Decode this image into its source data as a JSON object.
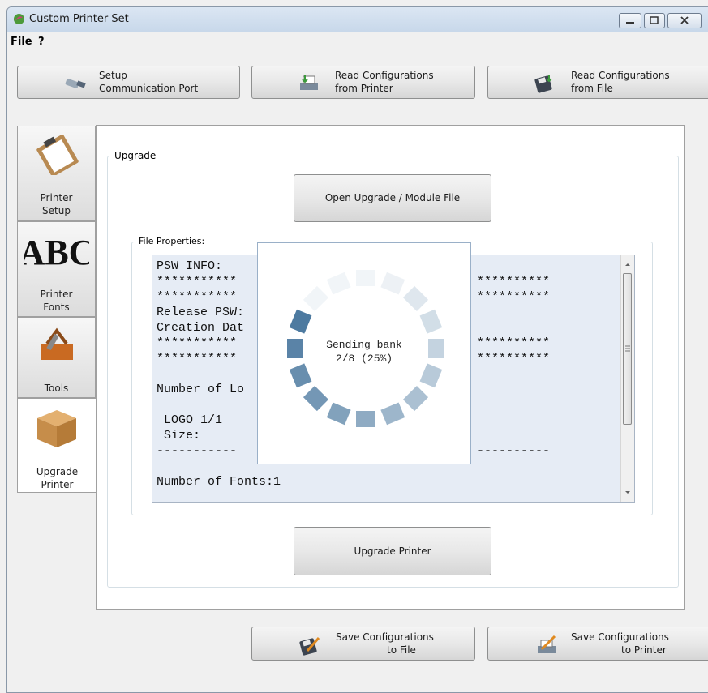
{
  "window": {
    "title": "Custom Printer Set",
    "controls": [
      "minimize",
      "maximize",
      "close"
    ]
  },
  "menu": {
    "file": "File",
    "help": "?"
  },
  "toolbar": {
    "setup_comm": [
      "Setup",
      "Communication Port"
    ],
    "read_printer": [
      "Read Configurations",
      "from Printer"
    ],
    "read_file": [
      "Read Configurations",
      "from File"
    ]
  },
  "tabs": [
    {
      "label": "Printer\nSetup",
      "icon": "clipboard-icon"
    },
    {
      "label": "Printer\nFonts",
      "icon": "abc-font-icon"
    },
    {
      "label": "Tools",
      "icon": "toolbox-icon"
    },
    {
      "label": "Upgrade\nPrinter",
      "icon": "box-fonts-icon",
      "active": true
    }
  ],
  "upgrade": {
    "group_title": "Upgrade",
    "open_button": "Open Upgrade / Module File",
    "file_properties_title": "File Properties:",
    "upgrade_button": "Upgrade Printer"
  },
  "file_text": {
    "left_lines": [
      "PSW INFO:",
      "***********",
      "***********",
      "Release PSW:",
      "Creation Dat",
      "***********",
      "***********",
      "",
      "Number of Lo",
      "",
      " LOGO 1/1",
      " Size:",
      "-----------",
      "",
      "Number of Fonts:1"
    ],
    "right_lines": [
      "",
      "**********",
      "**********",
      "",
      "",
      "**********",
      "**********",
      "",
      "",
      "",
      "",
      "",
      "----------"
    ]
  },
  "progress": {
    "line1": "Sending bank",
    "line2": "2/8 (25%)",
    "fraction": 0.25
  },
  "bottom": {
    "save_file": [
      "Save Configurations",
      "to File"
    ],
    "save_printer": [
      "Save Configurations",
      "to Printer"
    ]
  },
  "colors": {
    "spinner": "#4d7aa0",
    "textarea_bg": "#e6ecf5"
  }
}
